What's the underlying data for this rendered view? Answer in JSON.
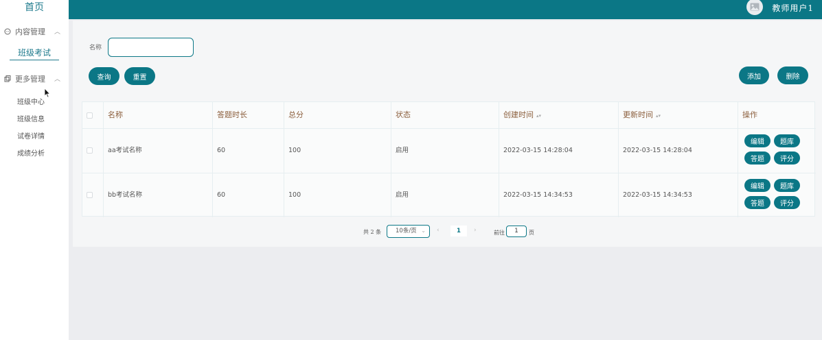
{
  "sidebar": {
    "home": "首页",
    "groups": [
      {
        "label": "内容管理",
        "icon": "chat-icon",
        "expanded": true
      },
      {
        "label": "更多管理",
        "icon": "copy-icon",
        "expanded": true
      }
    ],
    "active_item": "班级考试",
    "sub_items": [
      "班级中心",
      "班级信息",
      "试卷详情",
      "成绩分析"
    ]
  },
  "header": {
    "user": "教师用户1",
    "brand_color": "#0b7786"
  },
  "search": {
    "label": "名称",
    "value": "",
    "query_button": "查询",
    "reset_button": "重置",
    "add_button": "添加",
    "delete_button": "删除"
  },
  "table": {
    "columns": [
      "名称",
      "答题时长",
      "总分",
      "状态",
      "创建时间",
      "更新时间",
      "操作"
    ],
    "rows": [
      {
        "name": "aa考试名称",
        "duration": "60",
        "score": "100",
        "status": "启用",
        "created": "2022-03-15 14:28:04",
        "updated": "2022-03-15 14:28:04"
      },
      {
        "name": "bb考试名称",
        "duration": "60",
        "score": "100",
        "status": "启用",
        "created": "2022-03-15 14:34:53",
        "updated": "2022-03-15 14:34:53"
      }
    ],
    "row_actions": [
      "编辑",
      "题库",
      "答题",
      "评分"
    ]
  },
  "pagination": {
    "total_text": "共 2 条",
    "page_size": "10条/页",
    "current_page": "1",
    "goto_label": "前往",
    "goto_value": "1",
    "page_word": "页"
  }
}
